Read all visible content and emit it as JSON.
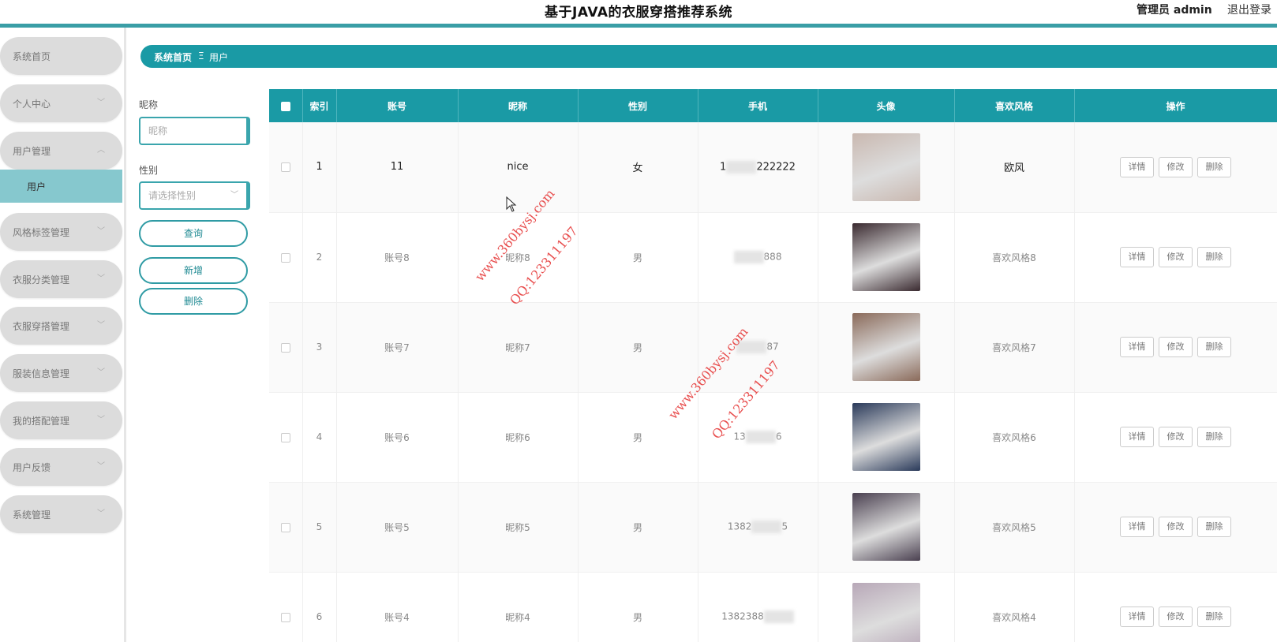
{
  "header": {
    "title": "基于JAVA的衣服穿搭推荐系统",
    "admin": "管理员 admin",
    "logout": "退出登录"
  },
  "sidebar": {
    "items": [
      {
        "label": "系统首页"
      },
      {
        "label": "个人中心"
      },
      {
        "label": "用户管理"
      },
      {
        "label": "用户"
      },
      {
        "label": "风格标签管理"
      },
      {
        "label": "衣服分类管理"
      },
      {
        "label": "衣服穿搭管理"
      },
      {
        "label": "服装信息管理"
      },
      {
        "label": "我的搭配管理"
      },
      {
        "label": "用户反馈"
      },
      {
        "label": "系统管理"
      }
    ]
  },
  "breadcrumb": {
    "home": "系统首页",
    "separator": "Ξ",
    "current": "用户"
  },
  "filters": {
    "nickname_label": "昵称",
    "nickname_placeholder": "昵称",
    "gender_label": "性别",
    "gender_placeholder": "请选择性别",
    "query_button": "查询",
    "add_button": "新增",
    "delete_button": "删除"
  },
  "table": {
    "headers": [
      "索引",
      "账号",
      "昵称",
      "性别",
      "手机",
      "头像",
      "喜欢风格",
      "操作"
    ],
    "action_labels": {
      "detail": "详情",
      "edit": "修改",
      "delete": "删除"
    },
    "rows": [
      {
        "index": "1",
        "account": "11",
        "nickname": "nice",
        "gender": "女",
        "phone_prefix": "1",
        "phone_suffix": "222222",
        "style": "欧风",
        "avatar_color": "#c9b8b0"
      },
      {
        "index": "2",
        "account": "账号8",
        "nickname": "昵称8",
        "gender": "男",
        "phone_prefix": "",
        "phone_suffix": "888",
        "style": "喜欢风格8",
        "avatar_color": "#3a2a30"
      },
      {
        "index": "3",
        "account": "账号7",
        "nickname": "昵称7",
        "gender": "男",
        "phone_prefix": "",
        "phone_suffix": "87",
        "style": "喜欢风格7",
        "avatar_color": "#8a6a5a"
      },
      {
        "index": "4",
        "account": "账号6",
        "nickname": "昵称6",
        "gender": "男",
        "phone_prefix": "13",
        "phone_suffix": "6",
        "style": "喜欢风格6",
        "avatar_color": "#2a3a5a"
      },
      {
        "index": "5",
        "account": "账号5",
        "nickname": "昵称5",
        "gender": "男",
        "phone_prefix": "1382",
        "phone_suffix": "5",
        "style": "喜欢风格5",
        "avatar_color": "#4a4050"
      },
      {
        "index": "6",
        "account": "账号4",
        "nickname": "昵称4",
        "gender": "男",
        "phone_prefix": "1382388",
        "phone_suffix": "",
        "style": "喜欢风格4",
        "avatar_color": "#b8a8b8"
      }
    ]
  },
  "watermarks": [
    {
      "line1": "www.360bysj.com",
      "line2": "QQ:123311197"
    }
  ],
  "colors": {
    "accent": "#1a9aa5",
    "watermark": "#e63b3b"
  }
}
